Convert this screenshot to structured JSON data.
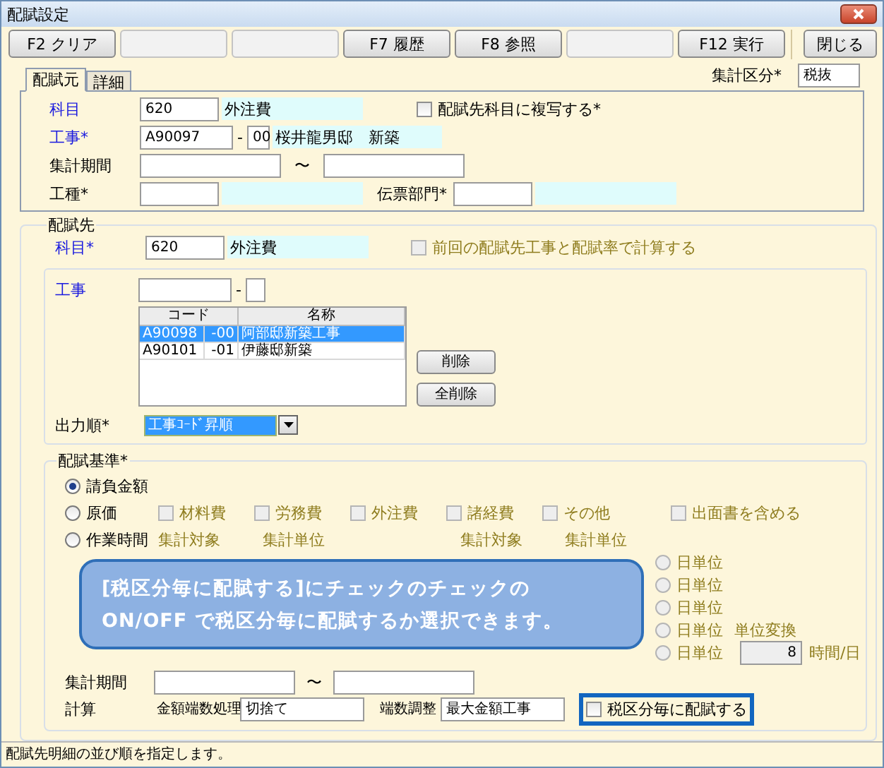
{
  "window": {
    "title": "配賦設定"
  },
  "toolbar": {
    "buttons": [
      {
        "kind": "key",
        "label": "F2 クリア"
      },
      {
        "kind": "blank"
      },
      {
        "kind": "blank"
      },
      {
        "kind": "key",
        "label": "F7 履歴"
      },
      {
        "kind": "key",
        "label": "F8 参照"
      },
      {
        "kind": "blank"
      },
      {
        "kind": "key",
        "label": "F12 実行"
      }
    ],
    "close_label": "閉じる"
  },
  "tabs": [
    {
      "label": "配賦元",
      "selected": true
    },
    {
      "label": "詳細",
      "selected": false
    }
  ],
  "summary_category": {
    "label": "集計区分*",
    "value": "税抜"
  },
  "source": {
    "account": {
      "label": "科目",
      "link": true,
      "code": "620",
      "name": "外注費"
    },
    "copy_check": {
      "label": "配賦先科目に複写する*",
      "checked": false
    },
    "project": {
      "label": "工事*",
      "link": true,
      "code": "A90097",
      "separator": "-",
      "branch": "00",
      "name": "桜井龍男邸　新築"
    },
    "period": {
      "label": "集計期間",
      "separator": "〜"
    },
    "work_type": {
      "label": "工種*"
    },
    "department": {
      "label": "伝票部門*"
    }
  },
  "destination": {
    "title": "配賦先",
    "account": {
      "label": "科目*",
      "link": true,
      "code": "620",
      "name": "外注費"
    },
    "previous_check": {
      "label": "前回の配賦先工事と配賦率で計算する",
      "checked": false,
      "disabled": true
    },
    "project": {
      "label": "工事",
      "link": true,
      "separator": "-"
    },
    "list": {
      "columns": [
        "コード",
        "名称"
      ],
      "rows": [
        {
          "code": "A90098",
          "branch": "-00",
          "name": "阿部邸新築工事",
          "selected": true
        },
        {
          "code": "A90101",
          "branch": "-01",
          "name": "伊藤邸新築",
          "selected": false
        }
      ]
    },
    "buttons": [
      "削除",
      "全削除"
    ],
    "order": {
      "label": "出力順*",
      "value": "工事ｺｰﾄﾞ昇順"
    }
  },
  "basis": {
    "title": "配賦基準*",
    "options": [
      {
        "label": "請負金額",
        "selected": true
      },
      {
        "label": "原価",
        "selected": false
      },
      {
        "label": "作業時間",
        "selected": false
      }
    ],
    "cost_checks": [
      {
        "label": "材料費",
        "checked": false,
        "disabled": true
      },
      {
        "label": "労務費",
        "checked": false,
        "disabled": true
      },
      {
        "label": "外注費",
        "checked": false,
        "disabled": true
      },
      {
        "label": "諸経費",
        "checked": false,
        "disabled": true
      },
      {
        "label": "その他",
        "checked": false,
        "disabled": true
      }
    ],
    "include_check": {
      "label": "出面書を含める",
      "checked": false,
      "disabled": true
    },
    "time_headers": [
      "集計対象",
      "集計単位",
      "集計対象",
      "集計単位"
    ],
    "day_units": [
      {
        "label": "日単位",
        "selected": false,
        "disabled": true
      },
      {
        "label": "日単位",
        "selected": false,
        "disabled": true
      },
      {
        "label": "日単位",
        "selected": false,
        "disabled": true
      },
      {
        "label": "日単位",
        "selected": false,
        "disabled": true
      },
      {
        "label": "日単位",
        "selected": false,
        "disabled": true
      }
    ],
    "conversion": {
      "label": "単位変換",
      "value": "8",
      "unit": "時間/日"
    },
    "period": {
      "label": "集計期間",
      "separator": "〜"
    },
    "calc": {
      "label": "計算",
      "rounding_label": "金額端数処理",
      "rounding": "切捨て",
      "adjust_label": "端数調整",
      "adjust": "最大金額工事"
    },
    "tax_check": {
      "label": "税区分毎に配賦する",
      "checked": false,
      "highlighted": true
    }
  },
  "callout": {
    "lines": [
      "[税区分毎に配賦する]にチェックのチェックの",
      "ON/OFF で税区分毎に配賦するか選択できます。"
    ]
  },
  "status_bar": {
    "text": "配賦先明細の並び順を指定します。"
  }
}
